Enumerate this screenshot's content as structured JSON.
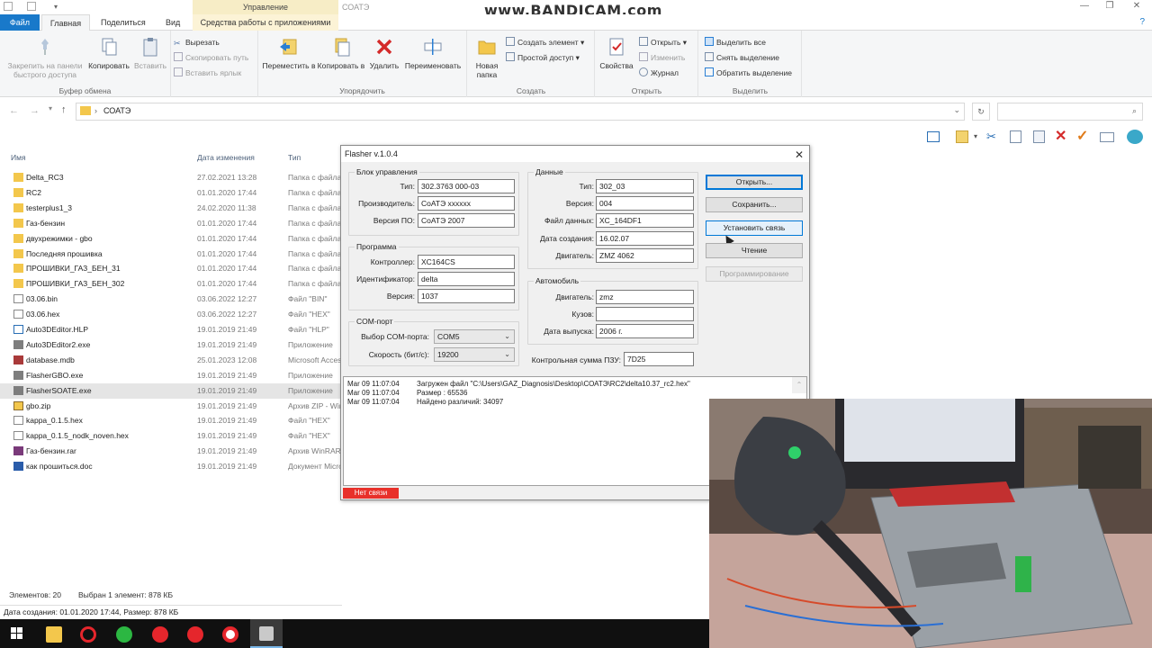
{
  "watermark": "www.BANDICAM.com",
  "window": {
    "title": "СОАТЭ",
    "manage_tab": "Управление"
  },
  "ribbon_tabs": {
    "file": "Файл",
    "home": "Главная",
    "share": "Поделиться",
    "view": "Вид",
    "tools": "Средства работы с приложениями"
  },
  "ribbon": {
    "clipboard": {
      "label": "Буфер обмена",
      "pin": "Закрепить на панели быстрого доступа",
      "copy": "Копировать",
      "paste": "Вставить",
      "cut": "Вырезать",
      "copy_path": "Скопировать путь",
      "paste_shortcut": "Вставить ярлык"
    },
    "organize": {
      "label": "Упорядочить",
      "move_to": "Переместить в",
      "copy_to": "Копировать в",
      "delete": "Удалить",
      "rename": "Переименовать"
    },
    "create": {
      "label": "Создать",
      "new_folder": "Новая папка",
      "new_item": "Создать элемент",
      "easy_access": "Простой доступ"
    },
    "open": {
      "label": "Открыть",
      "properties": "Свойства",
      "open": "Открыть",
      "edit": "Изменить",
      "history": "Журнал"
    },
    "select": {
      "label": "Выделить",
      "select_all": "Выделить все",
      "select_none": "Снять выделение",
      "invert": "Обратить выделение"
    }
  },
  "address": {
    "path": "СОАТЭ",
    "separator": "›"
  },
  "columns": {
    "name": "Имя",
    "date": "Дата изменения",
    "type": "Тип"
  },
  "files": [
    {
      "name": "Delta_RC3",
      "date": "27.02.2021 13:28",
      "type": "Папка с файлами",
      "icon": "folder"
    },
    {
      "name": "RC2",
      "date": "01.01.2020 17:44",
      "type": "Папка с файлами",
      "icon": "folder"
    },
    {
      "name": "testerplus1_3",
      "date": "24.02.2020 11:38",
      "type": "Папка с файлами",
      "icon": "folder"
    },
    {
      "name": "Газ-бензин",
      "date": "01.01.2020 17:44",
      "type": "Папка с файлами",
      "icon": "folder"
    },
    {
      "name": "двухрежимки - gbo",
      "date": "01.01.2020 17:44",
      "type": "Папка с файлами",
      "icon": "folder"
    },
    {
      "name": "Последняя прошивка",
      "date": "01.01.2020 17:44",
      "type": "Папка с файлами",
      "icon": "folder"
    },
    {
      "name": "ПРОШИВКИ_ГАЗ_БЕН_31",
      "date": "01.01.2020 17:44",
      "type": "Папка с файлами",
      "icon": "folder"
    },
    {
      "name": "ПРОШИВКИ_ГАЗ_БЕН_302",
      "date": "01.01.2020 17:44",
      "type": "Папка с файлами",
      "icon": "folder"
    },
    {
      "name": "03.06.bin",
      "date": "03.06.2022 12:27",
      "type": "Файл \"BIN\"",
      "icon": "file"
    },
    {
      "name": "03.06.hex",
      "date": "03.06.2022 12:27",
      "type": "Файл \"HEX\"",
      "icon": "file"
    },
    {
      "name": "Auto3DEditor.HLP",
      "date": "19.01.2019 21:49",
      "type": "Файл \"HLP\"",
      "icon": "help"
    },
    {
      "name": "Auto3DEditor2.exe",
      "date": "19.01.2019 21:49",
      "type": "Приложение",
      "icon": "exe"
    },
    {
      "name": "database.mdb",
      "date": "25.01.2023 12:08",
      "type": "Microsoft Access",
      "icon": "db"
    },
    {
      "name": "FlasherGBO.exe",
      "date": "19.01.2019 21:49",
      "type": "Приложение",
      "icon": "exe"
    },
    {
      "name": "FlasherSOATE.exe",
      "date": "19.01.2019 21:49",
      "type": "Приложение",
      "icon": "exe"
    },
    {
      "name": "gbo.zip",
      "date": "19.01.2019 21:49",
      "type": "Архив ZIP - WinRAR",
      "icon": "zip"
    },
    {
      "name": "kappa_0.1.5.hex",
      "date": "19.01.2019 21:49",
      "type": "Файл \"HEX\"",
      "icon": "file"
    },
    {
      "name": "kappa_0.1.5_nodk_noven.hex",
      "date": "19.01.2019 21:49",
      "type": "Файл \"HEX\"",
      "icon": "file"
    },
    {
      "name": "Газ-бензин.rar",
      "date": "19.01.2019 21:49",
      "type": "Архив WinRAR",
      "icon": "rar"
    },
    {
      "name": "как прошиться.doc",
      "date": "19.01.2019 21:49",
      "type": "Документ Microsoft",
      "icon": "doc"
    }
  ],
  "status": {
    "count": "Элементов: 20",
    "selected": "Выбран 1 элемент: 878 КБ",
    "details": "Дата создания: 01.01.2020 17:44, Размер: 878 КБ"
  },
  "flasher": {
    "title": "Flasher v.1.0.4",
    "control_unit": {
      "legend": "Блок управления",
      "type_label": "Тип:",
      "type": "302.3763 000-03",
      "maker_label": "Производитель:",
      "maker": "СоАТЭ xxxxxx",
      "sw_label": "Версия ПО:",
      "sw": "СоАТЭ 2007"
    },
    "program": {
      "legend": "Программа",
      "controller_label": "Контроллер:",
      "controller": "XC164CS",
      "id_label": "Идентификатор:",
      "id": "delta",
      "version_label": "Версия:",
      "version": "1037"
    },
    "com": {
      "legend": "COM-порт",
      "port_label": "Выбор COM-порта:",
      "port": "COM5",
      "speed_label": "Скорость (бит/с):",
      "speed": "19200"
    },
    "data": {
      "legend": "Данные",
      "type_label": "Тип:",
      "type": "302_03",
      "version_label": "Версия:",
      "version": "004",
      "file_label": "Файл данных:",
      "file": "XC_164DF1",
      "created_label": "Дата создания:",
      "created": "16.02.07",
      "engine_label": "Двигатель:",
      "engine": "ZMZ 4062"
    },
    "car": {
      "legend": "Автомобиль",
      "engine_label": "Двигатель:",
      "engine": "zmz",
      "body_label": "Кузов:",
      "body": "",
      "year_label": "Дата выпуска:",
      "year": "2006 г."
    },
    "checksum_label": "Контрольная сумма ПЗУ:",
    "checksum": "7D25",
    "buttons": {
      "open": "Открыть...",
      "save": "Сохранить...",
      "connect": "Установить связь",
      "read": "Чтение",
      "program": "Программирование"
    },
    "log": [
      {
        "time": "Mar 09 11:07:04",
        "msg": "Загружен файл \"C:\\Users\\GAZ_Diagnosis\\Desktop\\СОАТЭ\\RC2\\delta10.37_rc2.hex\""
      },
      {
        "time": "Mar 09 11:07:04",
        "msg": "Размер : 65536"
      },
      {
        "time": "Mar 09 11:07:04",
        "msg": "Найдено различий: 34097"
      }
    ],
    "status": "Нет связи"
  },
  "colors": {
    "accent": "#1979ca",
    "error": "#e8302a",
    "folder": "#f3c74c"
  }
}
